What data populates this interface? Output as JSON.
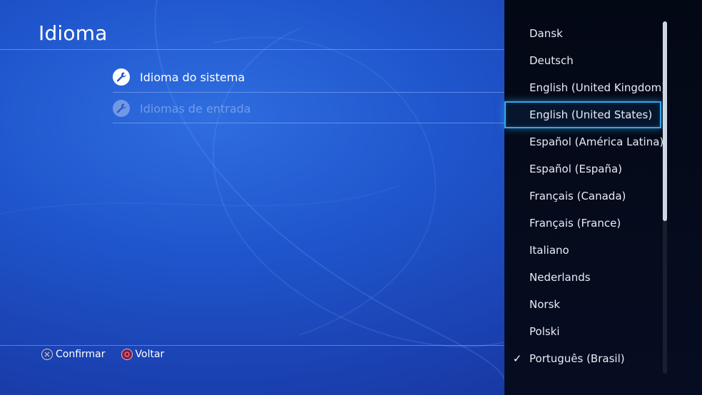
{
  "header": {
    "title": "Idioma"
  },
  "menu": {
    "items": [
      {
        "label": "Idioma do sistema",
        "icon": "wrench-icon",
        "enabled": true
      },
      {
        "label": "Idiomas de entrada",
        "icon": "wrench-icon",
        "enabled": false
      }
    ]
  },
  "footer": {
    "confirm_label": "Confirmar",
    "confirm_icon": "cross-button-icon",
    "back_label": "Voltar",
    "back_icon": "circle-button-icon"
  },
  "language_list": {
    "focused": "English (United States)",
    "selected": "Português (Brasil)",
    "items": [
      "Dansk",
      "Deutsch",
      "English (United Kingdom)",
      "English (United States)",
      "Español (América Latina)",
      "Español (España)",
      "Français (Canada)",
      "Français (France)",
      "Italiano",
      "Nederlands",
      "Norsk",
      "Polski",
      "Português (Brasil)"
    ]
  },
  "colors": {
    "background": "#1f55cc",
    "panel": "#050b1b",
    "focus_border": "#34a7e8",
    "text": "#ffffff"
  }
}
